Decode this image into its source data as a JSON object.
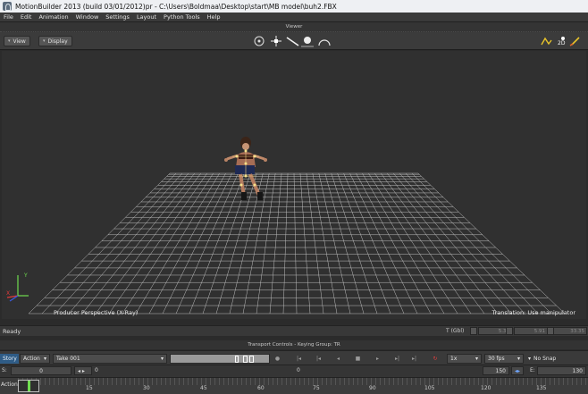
{
  "title": "MotionBuilder 2013  (build 03/01/2012)pr  - C:\\Users\\Boldmaa\\Desktop\\start\\MB model\\buh2.FBX",
  "menu": [
    "File",
    "Edit",
    "Animation",
    "Window",
    "Settings",
    "Layout",
    "Python Tools",
    "Help"
  ],
  "viewer": {
    "panel_title": "Viewer",
    "view_button": "View",
    "display_button": "Display",
    "camera_label": "Producer Perspective (X-Ray)",
    "manip_label": "Translation: Use manipulator",
    "axis_x": "X",
    "axis_y": "Y",
    "mode_2d": "2D"
  },
  "status": {
    "text": "Ready",
    "coord_label": "T (Gbl)",
    "x": "5.33",
    "y": "5.91",
    "z": "33.35"
  },
  "transport": {
    "panel_title": "Transport Controls  -  Keying Group: TR",
    "story_button": "Story",
    "action_mode": "Action",
    "take": "Take 001",
    "speed": "1x",
    "fps": "30 fps",
    "snap": "No Snap"
  },
  "range": {
    "start_label": "S:",
    "start_value": "0",
    "current_value": "0",
    "mid_value": "0",
    "stop_value": "150",
    "end_label": "E:",
    "end_value": "130"
  },
  "timeline": {
    "mode": "Action",
    "ticks": [
      "15",
      "30",
      "45",
      "60",
      "75",
      "90",
      "105",
      "120",
      "135"
    ]
  }
}
